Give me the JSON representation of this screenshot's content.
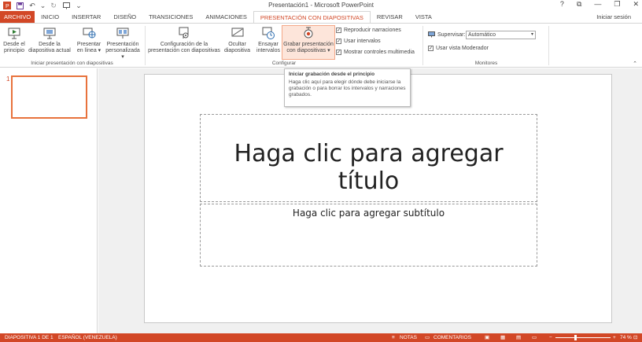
{
  "window": {
    "title": "Presentación1 - Microsoft PowerPoint",
    "help": "?",
    "restore": "⧉",
    "minimize": "—",
    "maximize": "❐",
    "close": "✕"
  },
  "qat": {
    "save": "💾",
    "undo": "↶",
    "undo_arrow": "⌄",
    "redo": "↻",
    "start": "🖵",
    "customize": "⌄"
  },
  "tabs": [
    {
      "label": "ARCHIVO"
    },
    {
      "label": "INICIO"
    },
    {
      "label": "INSERTAR"
    },
    {
      "label": "DISEÑO"
    },
    {
      "label": "TRANSICIONES"
    },
    {
      "label": "ANIMACIONES"
    },
    {
      "label": "PRESENTACIÓN CON DIAPOSITIVAS"
    },
    {
      "label": "REVISAR"
    },
    {
      "label": "VISTA"
    }
  ],
  "signin": "Iniciar sesión",
  "ribbon": {
    "from_beginning": {
      "l1": "Desde el",
      "l2": "principio"
    },
    "from_current": {
      "l1": "Desde la",
      "l2": "diapositiva actual"
    },
    "present_online": {
      "l1": "Presentar",
      "l2": "en línea ▾"
    },
    "custom_show": {
      "l1": "Presentación",
      "l2": "personalizada ▾"
    },
    "group_start": "Iniciar presentación con diapositivas",
    "setup": {
      "l1": "Configuración de la",
      "l2": "presentación con diapositivas"
    },
    "hide_slide": {
      "l1": "Ocultar",
      "l2": "diapositiva"
    },
    "rehearse": {
      "l1": "Ensayar",
      "l2": "intervalos"
    },
    "record": {
      "l1": "Grabar presentación",
      "l2": "con diapositivas ▾"
    },
    "play_narrations": "Reproducir narraciones",
    "use_timings": "Usar intervalos",
    "show_media_controls": "Mostrar controles multimedia",
    "group_setup": "Configurar",
    "monitor_label": "Supervisar:",
    "monitor_value": "Automático",
    "presenter_view": "Usar vista Moderador",
    "group_monitors": "Monitores"
  },
  "tooltip": {
    "title": "Iniciar grabación desde el principio",
    "body": "Haga clic aquí para elegir dónde debe iniciarse la grabación o para borrar los intervalos y narraciones grabados."
  },
  "thumbnails": [
    {
      "number": "1"
    }
  ],
  "slide": {
    "title_placeholder": "Haga clic para agregar título",
    "subtitle_placeholder": "Haga clic para agregar subtítulo"
  },
  "status": {
    "slide": "DIAPOSITIVA 1 DE 1",
    "language": "ESPAÑOL (VENEZUELA)",
    "notes": "NOTAS",
    "comments": "COMENTARIOS",
    "zoom_minus": "−",
    "zoom_plus": "+",
    "zoom": "74 %",
    "zoom_level": 0.74
  },
  "colors": {
    "accent": "#d24726",
    "selected_border": "#e8723c"
  }
}
